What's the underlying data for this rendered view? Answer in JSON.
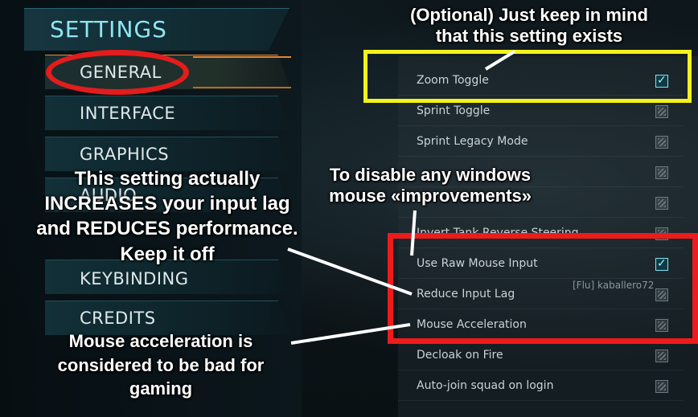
{
  "settings": {
    "title": "SETTINGS",
    "menu": [
      {
        "label": "GENERAL",
        "active": true
      },
      {
        "label": "INTERFACE"
      },
      {
        "label": "GRAPHICS"
      },
      {
        "label": "AUDIO"
      },
      {
        "label": "KEYBINDING"
      },
      {
        "label": "CREDITS"
      }
    ]
  },
  "options": [
    {
      "label": "Zoom Toggle",
      "checked": true
    },
    {
      "label": "Sprint Toggle",
      "checked": false
    },
    {
      "label": "Sprint Legacy Mode",
      "checked": false
    },
    {
      "label": "",
      "checked": false
    },
    {
      "label": "",
      "checked": false
    },
    {
      "label": "Invert Tank Reverse Steering",
      "checked": false
    },
    {
      "label": "Use Raw Mouse Input",
      "checked": true
    },
    {
      "label": "Reduce Input Lag",
      "checked": false
    },
    {
      "label": "Mouse Acceleration",
      "checked": false
    },
    {
      "label": "Decloak on Fire",
      "checked": false
    },
    {
      "label": "Auto-join squad on login",
      "checked": false
    }
  ],
  "player_tag": "[Flu] kaballero72",
  "annotations": {
    "optional_line1": "(Optional) Just keep in mind",
    "optional_line2": "that this setting exists",
    "input_lag_line1": "This setting actually",
    "input_lag_line2": "INCREASES your input lag",
    "input_lag_line3": "and REDUCES performance.",
    "input_lag_line4": "Keep it off",
    "raw_input_line1": "To disable any windows",
    "raw_input_line2": "mouse «improvements»",
    "accel_line1": "Mouse acceleration is",
    "accel_line2": "considered to be bad for",
    "accel_line3": "gaming"
  },
  "colors": {
    "highlight_yellow": "#f4f21a",
    "highlight_red": "#ee1b1b",
    "accent_cyan": "#8fe6f2",
    "accent_orange": "#e58630"
  }
}
